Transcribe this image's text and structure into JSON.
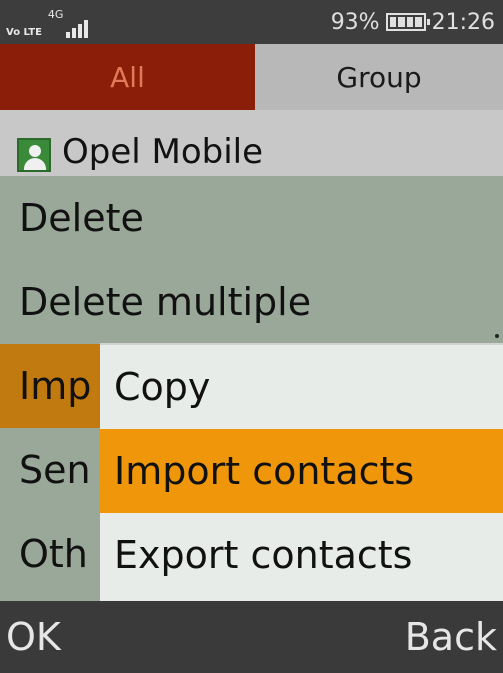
{
  "status_bar": {
    "volte": "Vo LTE",
    "network": "4G",
    "battery_percent": "93%",
    "battery_level": 0.93,
    "time": "21:26",
    "signal_bars": 4
  },
  "tabs": [
    {
      "label": "All",
      "selected": true
    },
    {
      "label": "Group",
      "selected": false
    }
  ],
  "contact": {
    "name": "Opel Mobile",
    "icon": "person-icon"
  },
  "menu": {
    "items": [
      {
        "label": "Delete"
      },
      {
        "label": "Delete multiple"
      },
      {
        "label": "Imp",
        "selected": true
      },
      {
        "label": "Sen"
      },
      {
        "label": "Oth"
      }
    ]
  },
  "submenu": {
    "items": [
      {
        "label": "Copy"
      },
      {
        "label": "Import contacts",
        "selected": true
      },
      {
        "label": "Export contacts"
      }
    ]
  },
  "softkeys": {
    "left": "OK",
    "right": "Back"
  },
  "colors": {
    "tab_active": "#8a1e08",
    "selection": "#f0960a",
    "menu_bg": "#9aa89a",
    "submenu_bg": "#e8ece8"
  }
}
